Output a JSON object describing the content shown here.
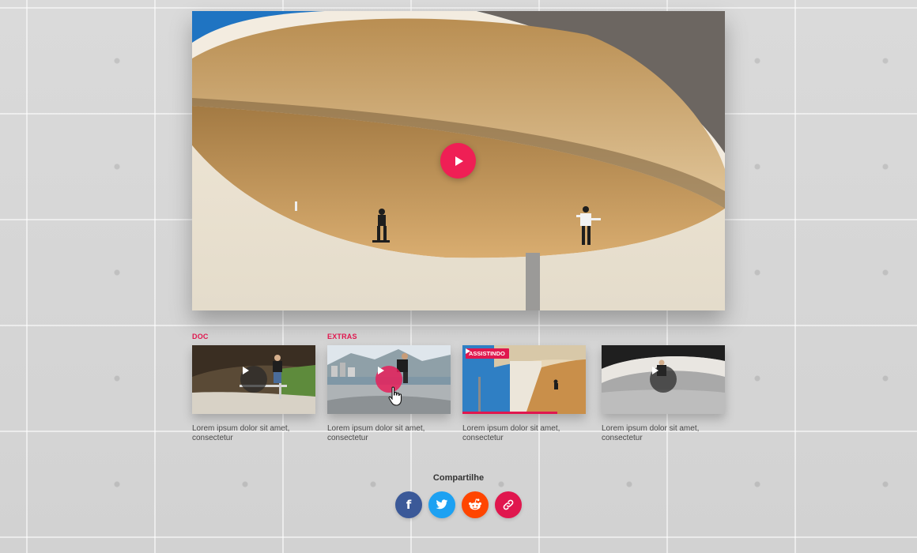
{
  "hero": {
    "play_icon": "play-icon",
    "play_color": "#ef1f55"
  },
  "videos": [
    {
      "tag": "DOC",
      "caption": "Lorem ipsum dolor sit amet, consectetur",
      "state": "idle"
    },
    {
      "tag": "EXTRAS",
      "caption": "Lorem ipsum dolor sit amet, consectetur",
      "state": "hover"
    },
    {
      "tag": "",
      "badge": "ASSISTINDO",
      "caption": "Lorem ipsum dolor sit amet, consectetur",
      "state": "playing",
      "progress_percent": 77
    },
    {
      "tag": "",
      "caption": "Lorem ipsum dolor sit amet, consectetur",
      "state": "idle"
    }
  ],
  "share": {
    "title": "Compartilhe",
    "buttons": [
      {
        "name": "facebook",
        "icon": "facebook-icon",
        "glyph": "f",
        "color": "#3b5998"
      },
      {
        "name": "twitter",
        "icon": "twitter-icon",
        "glyph": "",
        "color": "#1da1f2"
      },
      {
        "name": "reddit",
        "icon": "reddit-icon",
        "glyph": "",
        "color": "#ff4500"
      },
      {
        "name": "copy-link",
        "icon": "link-icon",
        "glyph": "",
        "color": "#e0174e"
      }
    ]
  },
  "colors": {
    "accent": "#e0174e",
    "caption": "#4a4a4a"
  }
}
